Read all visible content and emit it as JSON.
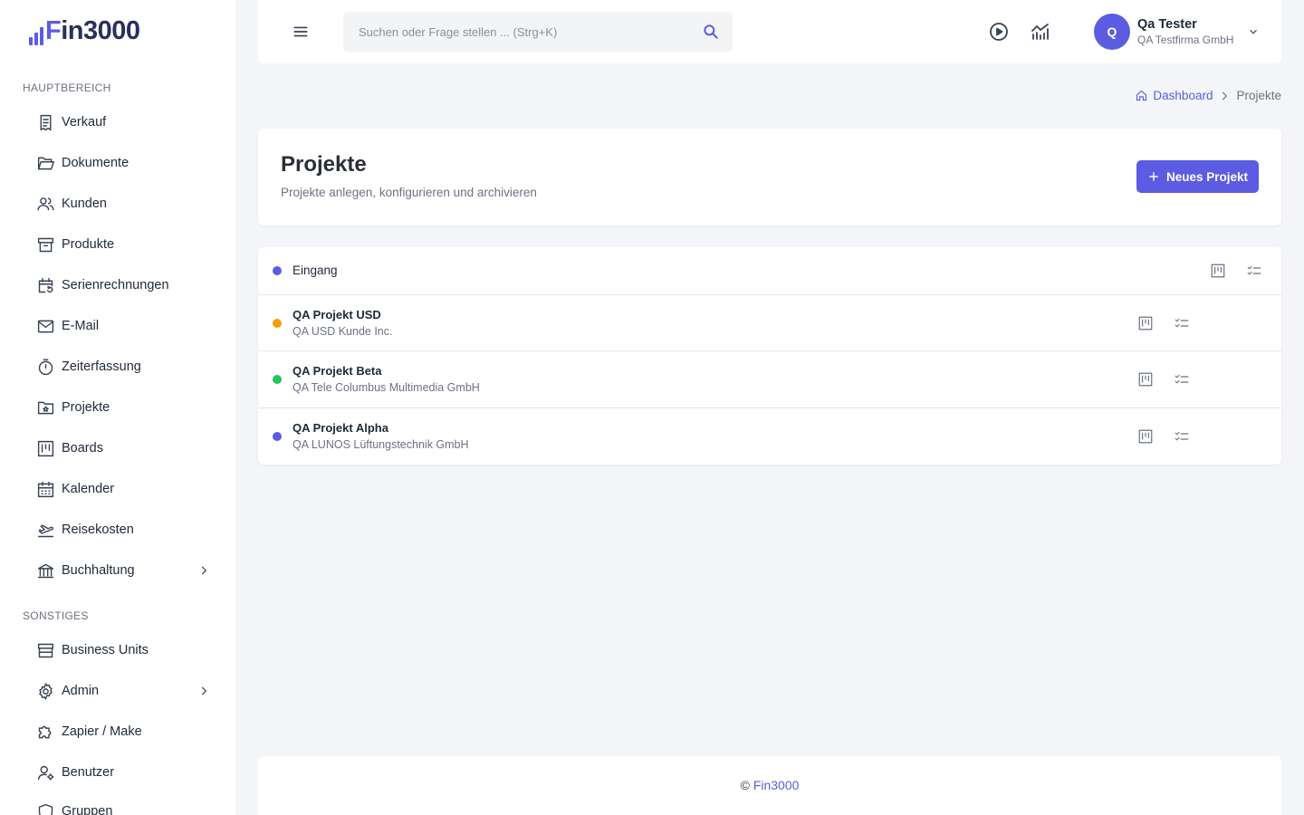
{
  "app": {
    "logo_prefix": "F",
    "logo_rest": "in3000"
  },
  "sidebar": {
    "section_main": "HAUPTBEREICH",
    "section_other": "SONSTIGES",
    "main_items": [
      {
        "label": "Verkauf",
        "icon": "receipt-icon"
      },
      {
        "label": "Dokumente",
        "icon": "folder-open-icon"
      },
      {
        "label": "Kunden",
        "icon": "users-icon"
      },
      {
        "label": "Produkte",
        "icon": "archive-box-icon"
      },
      {
        "label": "Serienrechnungen",
        "icon": "calendar-recurring-icon"
      },
      {
        "label": "E-Mail",
        "icon": "envelope-icon"
      },
      {
        "label": "Zeiterfassung",
        "icon": "stopwatch-icon"
      },
      {
        "label": "Projekte",
        "icon": "folder-star-icon"
      },
      {
        "label": "Boards",
        "icon": "kanban-icon"
      },
      {
        "label": "Kalender",
        "icon": "calendar-icon"
      },
      {
        "label": "Reisekosten",
        "icon": "plane-departure-icon"
      },
      {
        "label": "Buchhaltung",
        "icon": "bank-icon",
        "expandable": true
      }
    ],
    "other_items": [
      {
        "label": "Business Units",
        "icon": "storefront-icon"
      },
      {
        "label": "Admin",
        "icon": "gear-icon",
        "expandable": true
      },
      {
        "label": "Zapier / Make",
        "icon": "puzzle-icon"
      },
      {
        "label": "Benutzer",
        "icon": "user-cog-icon"
      },
      {
        "label": "Gruppen",
        "icon": "shield-icon"
      }
    ]
  },
  "topbar": {
    "search_placeholder": "Suchen oder Frage stellen ... (Strg+K)",
    "user": {
      "initial": "Q",
      "name": "Qa Tester",
      "company": "QA Testfirma GmbH"
    }
  },
  "breadcrumb": {
    "home": "Dashboard",
    "current": "Projekte"
  },
  "page": {
    "title": "Projekte",
    "subtitle": "Projekte anlegen, konfigurieren und archivieren",
    "new_button": "Neues Projekt"
  },
  "projects": {
    "group": {
      "label": "Eingang",
      "color": "#5b5ce2"
    },
    "rows": [
      {
        "title": "QA Projekt USD",
        "customer": "QA USD Kunde Inc.",
        "color": "#f59e0b"
      },
      {
        "title": "QA Projekt Beta",
        "customer": "QA Tele Columbus Multimedia GmbH",
        "color": "#22c55e"
      },
      {
        "title": "QA Projekt Alpha",
        "customer": "QA LUNOS Lüftungstechnik GmbH",
        "color": "#5b5ce2"
      }
    ]
  },
  "footer": {
    "copyright": "©",
    "link": "Fin3000"
  },
  "colors": {
    "accent": "#5b5ce2"
  }
}
